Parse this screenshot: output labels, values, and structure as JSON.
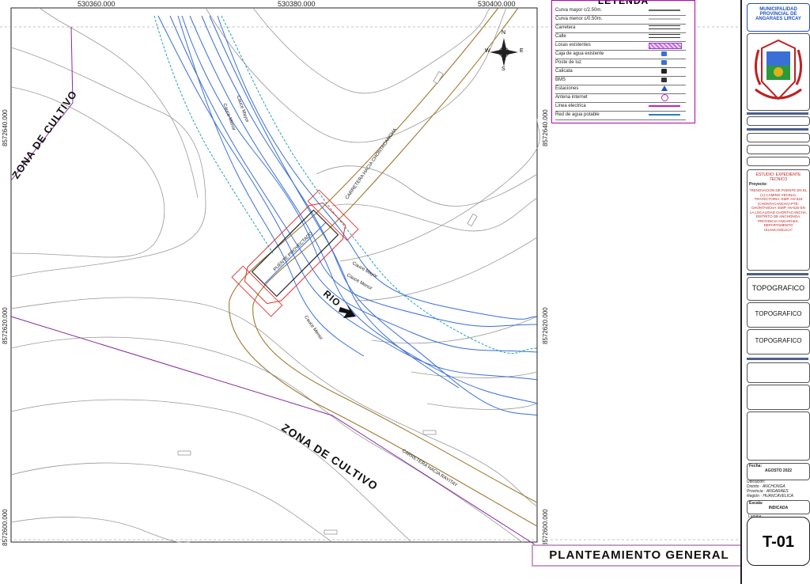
{
  "coords": {
    "top": [
      "530360.000",
      "530380.000",
      "530400.000"
    ],
    "left": [
      "8572640.000",
      "8572620.000",
      "8572600.000"
    ],
    "right": [
      "8572640.000",
      "8572620.000",
      "8572600.000"
    ]
  },
  "map_labels": {
    "zona_cultivo_top": "ZONA DE CULTIVO",
    "zona_cultivo_main": "ZONA DE CULTIVO",
    "rio": "RIO",
    "road_top": "CARRETERA HACIA CHONTACANCHA",
    "road_bottom": "CARRETERA HACIA RAYITAY",
    "bridge": "PUENTE PROYECTADO",
    "cauce_mayor": "Cauce Mayor",
    "cauce_menor": "Cauce Menor"
  },
  "legend": {
    "title": "LEYENDA",
    "items": [
      {
        "label": "Curva mayor c/2.50m.",
        "symbol": "line-gray"
      },
      {
        "label": "Curva menor c/0.50m.",
        "symbol": "line-lightgray"
      },
      {
        "label": "Carretera",
        "symbol": "double-line"
      },
      {
        "label": "Calle",
        "symbol": "double-line"
      },
      {
        "label": "Losas existentes",
        "symbol": "hatch-magenta"
      },
      {
        "label": "Caja de agua existente",
        "symbol": "water-box-icon"
      },
      {
        "label": "Poste de luz",
        "symbol": "light-post-icon"
      },
      {
        "label": "Calicata",
        "symbol": "calicata-icon"
      },
      {
        "label": "BMS",
        "symbol": "bm-icon"
      },
      {
        "label": "Estaciones",
        "symbol": "triangle-icon"
      },
      {
        "label": "Antena internet",
        "symbol": "circle-icon"
      },
      {
        "label": "Linea electrica",
        "symbol": "line-magenta"
      },
      {
        "label": "Red de agua potable",
        "symbol": "line-blue"
      }
    ]
  },
  "north": {
    "n": "N",
    "s": "S",
    "e": "E",
    "w": "W"
  },
  "title_block": {
    "municipality": "MUNICIPALIDAD PROVINCIAL DE ANGARAES LIRCAY",
    "proyecto_label": "Proyecto:",
    "proyecto_text": "\"RENOVACION DE PUENTE EN EL (A) CAMINO VECINAL TRAYECTORIA: EMP. HV-618 (CHONTACANCHA)-PTE. CHONTANCHA -EMP. HV-620 EN LA LOCALIDAD CHONTACANCHA, DISTRITO DE ANCHONGA, PROVINCIA ANGARAES, DEPARTAMENTO HUANCAVELICA\"",
    "estudio": "ESTUDIO: EXPEDIENTE TECNICO",
    "plano_1": "TOPOGRAFICO",
    "plano_2": "TOPOGRAFICO",
    "plano_3": "TOPOGRAFICO",
    "fecha_label": "Fecha:",
    "fecha": "AGOSTO 2022",
    "ubicacion_label": "Ubicación:",
    "distrito_label": "Distrito",
    "distrito": "ANCHONGA",
    "provincia_label": "Provincia",
    "provincia": "ANGARAES",
    "region_label": "Región",
    "region": "HUANCAVELICA",
    "escala_label": "Escala:",
    "escala": "INDICADA",
    "lamina_label": "Lamina:",
    "lamina": "T-01"
  },
  "plan_title": "PLANTEAMIENTO GENERAL"
}
